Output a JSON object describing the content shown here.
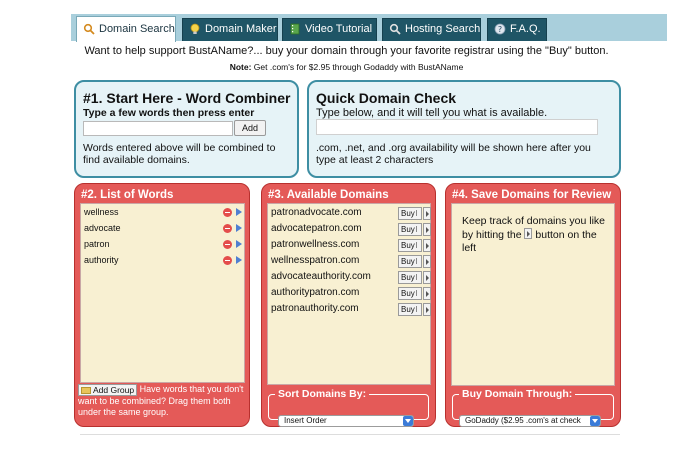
{
  "tabs": [
    {
      "label": "Domain Search",
      "icon": "magnifier-icon",
      "active": true
    },
    {
      "label": "Domain Maker",
      "icon": "lightbulb-icon",
      "active": false
    },
    {
      "label": "Video Tutorial",
      "icon": "film-icon",
      "active": false
    },
    {
      "label": "Hosting Search",
      "icon": "magnifier-icon",
      "active": false
    },
    {
      "label": "F.A.Q.",
      "icon": "help-icon",
      "active": false
    }
  ],
  "support_text": "Want to help support BustAName?... buy your domain through your favorite registrar using the \"Buy\" button.",
  "note_label": "Note:",
  "note_text": " Get .com's for $2.95 through Godaddy with BustAName",
  "word_combiner": {
    "title": "#1. Start Here - Word Combiner",
    "subtitle": "Type a few words then press enter",
    "input_value": "",
    "add_label": "Add",
    "description": "Words entered above will be combined to find available domains."
  },
  "quick_check": {
    "title": "Quick Domain Check",
    "subtitle": "Type below, and it will tell you what is available.",
    "input_value": "",
    "description": ".com, .net, and .org availability will be shown here after you type at least 2 characters"
  },
  "list_of_words": {
    "title": "#2. List of Words",
    "words": [
      "wellness",
      "advocate",
      "patron",
      "authority"
    ],
    "add_group_label": "Add Group",
    "group_hint": "Have words that you don't want to be combined?  Drag them both under the same group."
  },
  "available_domains": {
    "title": "#3. Available Domains",
    "buy_label": "Buy",
    "domains": [
      "patronadvocate.com",
      "advocatepatron.com",
      "patronwellness.com",
      "wellnesspatron.com",
      "advocateauthority.com",
      "authoritypatron.com",
      "patronauthority.com"
    ],
    "sort_legend": "Sort Domains By:",
    "sort_value": "Insert Order"
  },
  "save_domains": {
    "title": "#4. Save Domains for Review",
    "keep_text_1": "Keep track of domains you like by hitting the",
    "keep_text_2": "button on the left",
    "buy_legend": "Buy Domain Through:",
    "registrar_value": "GoDaddy ($2.95 .com's at check"
  },
  "colors": {
    "tab_bar": "#a9cfdc",
    "tab_dark": "#1f5566",
    "blue_border": "#3e8ea3",
    "blue_fill": "#e6f3f7",
    "red_fill": "#e45a58",
    "panel_fill": "#f8f0d2"
  }
}
